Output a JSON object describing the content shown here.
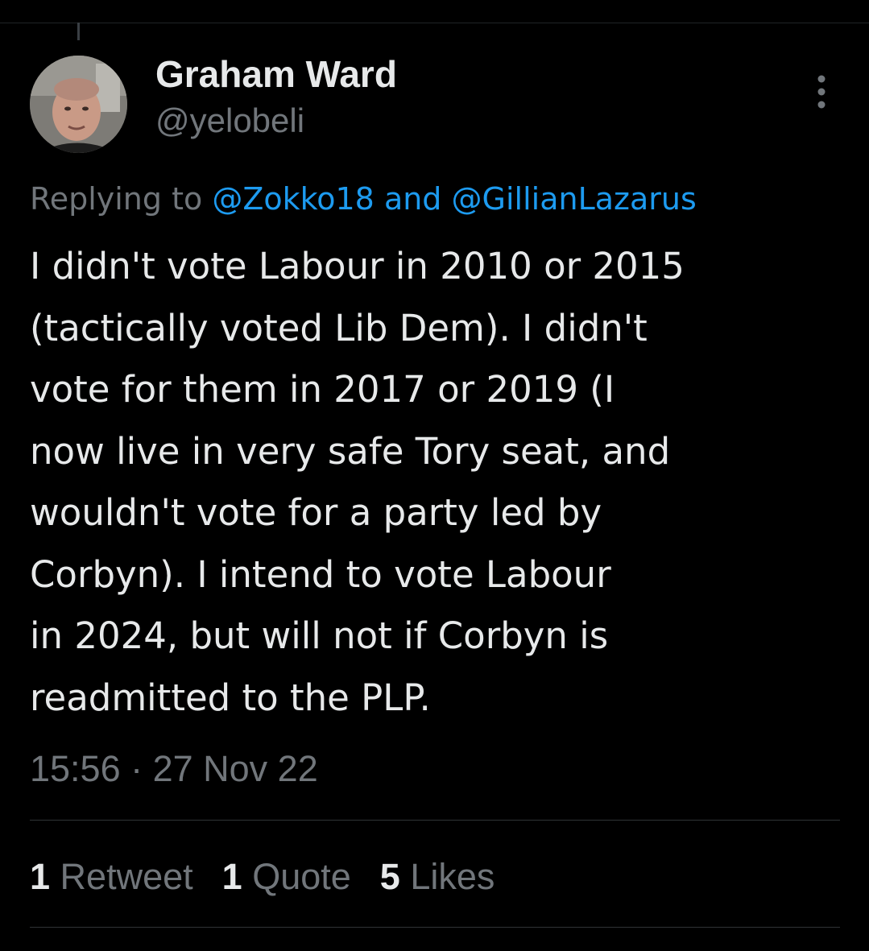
{
  "tweet": {
    "author": {
      "display_name": "Graham Ward",
      "handle": "@yelobeli",
      "avatar_icon": "profile-photo"
    },
    "more_icon": "more-options-icon",
    "reply_context": {
      "prefix": "Replying to ",
      "mention_1": "@Zokko18",
      "joiner": " and ",
      "mention_2": "@GillianLazarus"
    },
    "text": "I didn't vote Labour in 2010 or 2015\n(tactically voted Lib Dem). I didn't\nvote for them in 2017 or 2019 (I\nnow live in very safe Tory seat, and\nwouldn't vote for a party led by\nCorbyn). I intend to vote Labour\nin 2024, but will not if Corbyn is\nreadmitted to the PLP.",
    "timestamp": "15:56 · 27 Nov 22",
    "stats": {
      "retweets_count": "1",
      "retweets_label": "Retweet",
      "quotes_count": "1",
      "quotes_label": "Quote",
      "likes_count": "5",
      "likes_label": "Likes"
    }
  },
  "colors": {
    "background": "#000000",
    "primary_text": "#e7e9ea",
    "secondary_text": "#71767b",
    "link": "#1d9bf0",
    "divider": "#2f3336"
  }
}
